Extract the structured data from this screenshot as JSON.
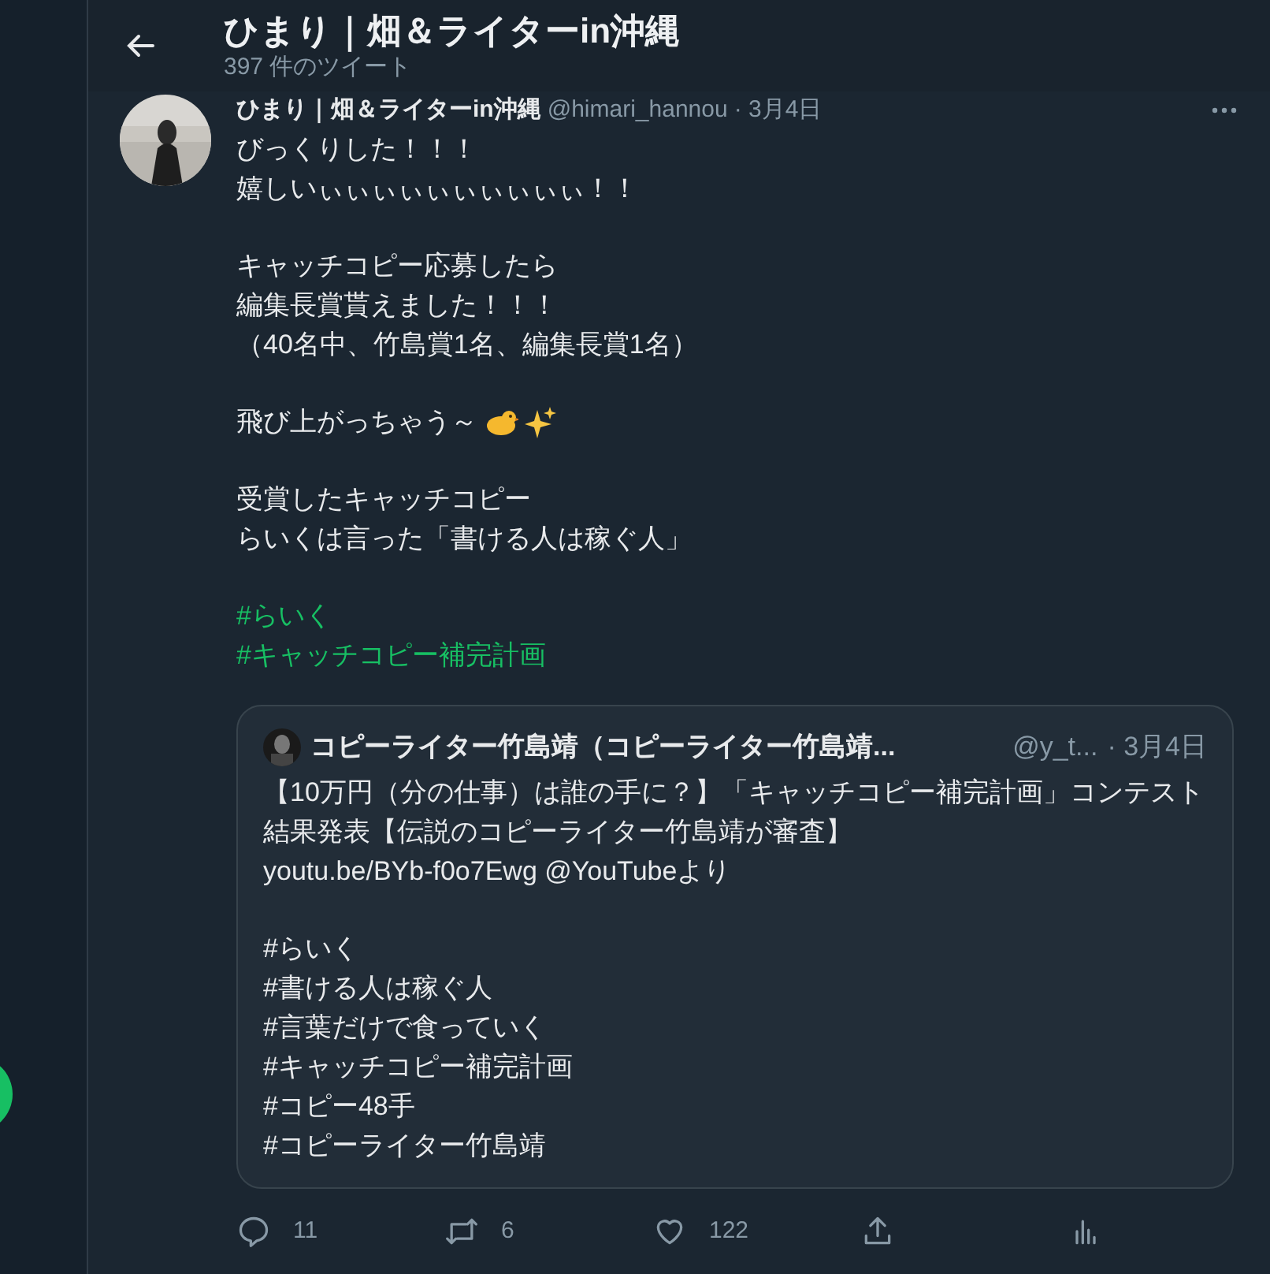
{
  "header": {
    "title": "ひまり｜畑＆ライターin沖縄",
    "subtitle": "397 件のツイート"
  },
  "tweet": {
    "author": "ひまり｜畑＆ライターin沖縄",
    "handle": "@himari_hannou",
    "date": "· 3月4日",
    "paragraphs": [
      {
        "kind": "text",
        "lines": [
          "びっくりした！！！",
          "嬉しいぃぃぃぃぃぃぃぃぃぃ！！"
        ]
      },
      {
        "kind": "text",
        "lines": [
          "キャッチコピー応募したら",
          "編集長賞貰えました！！！",
          "（40名中、竹島賞1名、編集長賞1名）"
        ]
      },
      {
        "kind": "icons",
        "lines": [
          "飛び上がっちゃう～"
        ]
      },
      {
        "kind": "text",
        "lines": [
          "受賞したキャッチコピー",
          "らいくは言った「書ける人は稼ぐ人」"
        ]
      },
      {
        "kind": "hashtags",
        "lines": [
          "#らいく",
          "#キャッチコピー補完計画"
        ]
      }
    ],
    "quote": {
      "author": "コピーライター竹島靖（コピーライター竹島靖...",
      "handle": "@y_t...",
      "date": "· 3月4日",
      "paragraphs": [
        {
          "kind": "text",
          "lines": [
            "【10万円（分の仕事）は誰の手に？】「キャッチコピー補完計画」コンテスト結果発表【伝説のコピーライター竹島靖が審査】",
            "youtu.be/BYb-f0o7Ewg @YouTubeより"
          ]
        },
        {
          "kind": "text",
          "lines": [
            "#らいく",
            "#書ける人は稼ぐ人",
            "#言葉だけで食っていく",
            "#キャッチコピー補完計画",
            "#コピー48手",
            "#コピーライター竹島靖"
          ]
        }
      ]
    },
    "actions": [
      {
        "kind": "reply",
        "count": "11"
      },
      {
        "kind": "retweet",
        "count": "6"
      },
      {
        "kind": "like",
        "count": "122"
      },
      {
        "kind": "share"
      },
      {
        "kind": "analytics"
      }
    ]
  }
}
